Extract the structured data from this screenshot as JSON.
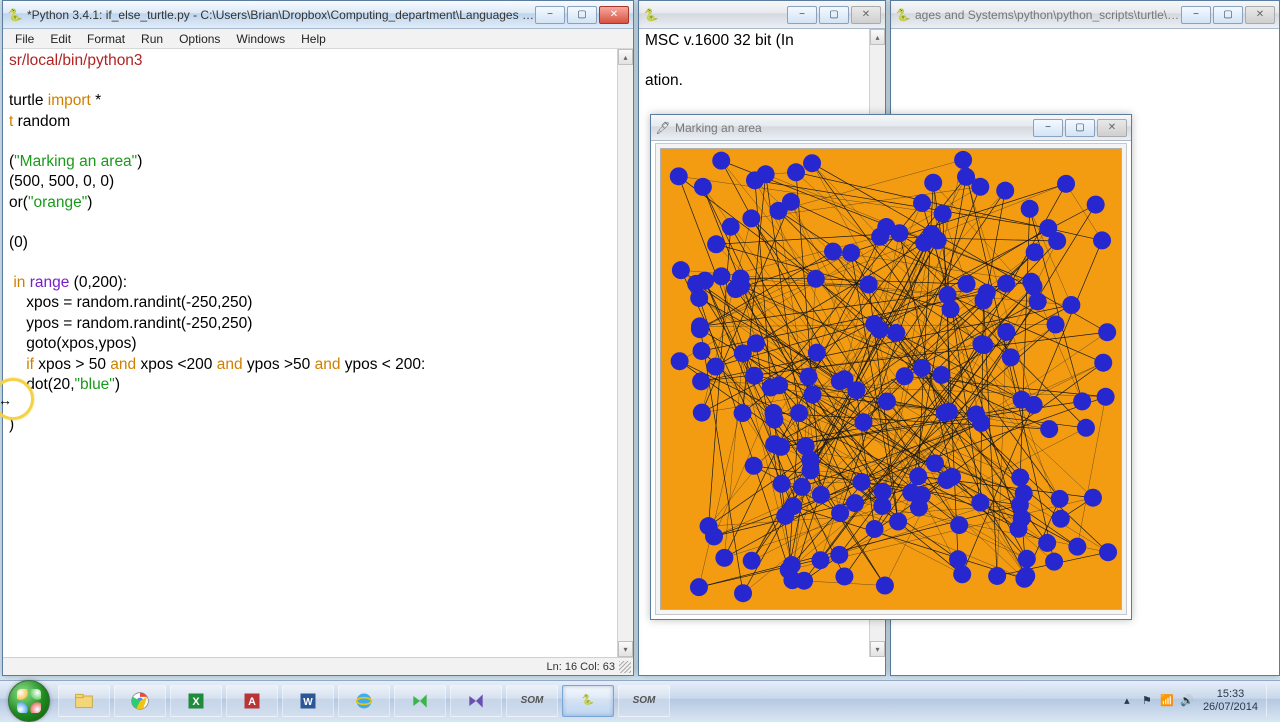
{
  "windows": {
    "editor": {
      "title": "*Python 3.4.1: if_else_turtle.py - C:\\Users\\Brian\\Dropbox\\Computing_department\\Languages and Sy...",
      "menus": [
        "File",
        "Edit",
        "Format",
        "Run",
        "Options",
        "Windows",
        "Help"
      ],
      "status": "Ln: 16 Col: 63",
      "code_parts": {
        "l1": "sr/local/bin/python3",
        "l3a": "turtle ",
        "l3b": "import",
        "l3c": " *",
        "l4a": "t",
        "l4b": " random",
        "l6a": "(",
        "l6b": "\"Marking an area\"",
        "l6c": ")",
        "l7a": "(",
        "l7b": "500",
        "l7c": ", ",
        "l7d": "500",
        "l7e": ", ",
        "l7f": "0",
        "l7g": ", ",
        "l7h": "0",
        "l7i": ")",
        "l8a": "or(",
        "l8b": "\"orange\"",
        "l8c": ")",
        "l10a": "(",
        "l10b": "0",
        "l10c": ")",
        "l12a": " ",
        "l12b": "in",
        "l12c": " ",
        "l12d": "range",
        "l12e": " (",
        "l12f": "0",
        "l12g": ",",
        "l12h": "200",
        "l12i": "):",
        "l13a": "    xpos = random.randint(-",
        "l13b": "250",
        "l13c": ",",
        "l13d": "250",
        "l13e": ")",
        "l14a": "    ypos = random.randint(-",
        "l14b": "250",
        "l14c": ",",
        "l14d": "250",
        "l14e": ")",
        "l15": "    goto(xpos,ypos)",
        "l16a": "    ",
        "l16b": "if",
        "l16c": " xpos > ",
        "l16d": "50",
        "l16e": " ",
        "l16f": "and",
        "l16g": " xpos <",
        "l16h": "200",
        "l16i": " ",
        "l16j": "and",
        "l16k": " ypos >",
        "l16l": "50",
        "l16m": " ",
        "l16n": "and",
        "l16o": " ypos < ",
        "l16p": "200",
        "l16q": ":",
        "l17a": "    dot(",
        "l17b": "20",
        "l17c": ",",
        "l17d": "\"blue\"",
        "l17e": ")",
        "l19": ")"
      }
    },
    "shell": {
      "title": "ages and Systems\\python\\python_scripts\\turtle\\if_else_tu...",
      "line1": "MSC v.1600 32 bit (In",
      "line2": "ation."
    },
    "turtle": {
      "title": "Marking an area"
    }
  },
  "taskbar": {
    "clock_time": "15:33",
    "clock_date": "26/07/2014",
    "som_label": "SOM"
  },
  "turtle_canvas": {
    "bg": "#f39c12",
    "dot_fill": "#2727cf",
    "line_stroke": "#1a1a1a",
    "num_dots": 160,
    "num_lines": 280
  }
}
